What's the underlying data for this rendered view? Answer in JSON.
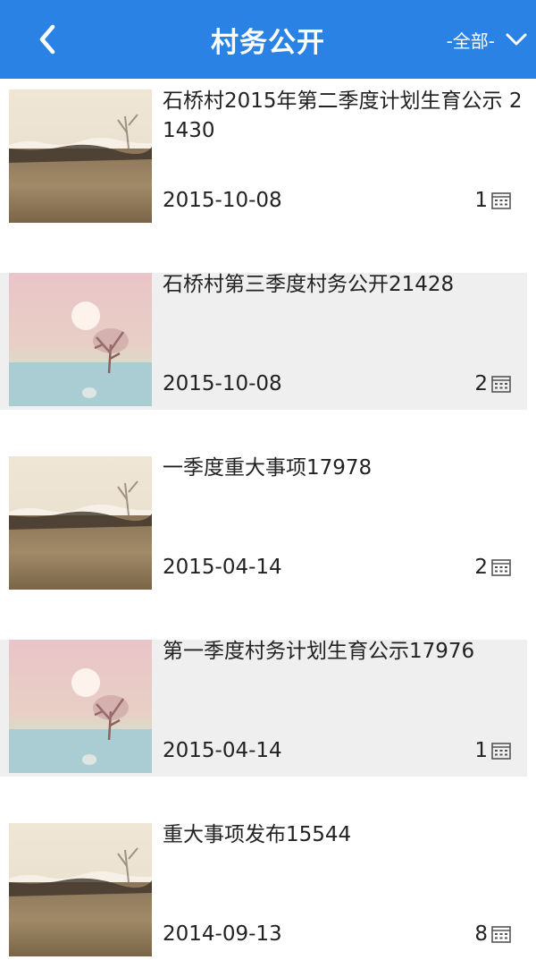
{
  "header": {
    "title": "村务公开",
    "filter_label": "-全部-",
    "bg_color": "#2a82e4"
  },
  "icons": {
    "back": "chevron-left-icon",
    "filter": "chevron-down-icon",
    "count": "calendar-icon"
  },
  "items": [
    {
      "title": "石桥村2015年第二季度计划生育公示 21430",
      "date": "2015-10-08",
      "count": "1",
      "thumb": "field"
    },
    {
      "title": "石桥村第三季度村务公开21428",
      "date": "2015-10-08",
      "count": "2",
      "thumb": "tree"
    },
    {
      "title": "一季度重大事项17978",
      "date": "2015-04-14",
      "count": "2",
      "thumb": "field"
    },
    {
      "title": "第一季度村务计划生育公示17976",
      "date": "2015-04-14",
      "count": "1",
      "thumb": "tree"
    },
    {
      "title": "重大事项发布15544",
      "date": "2014-09-13",
      "count": "8",
      "thumb": "field"
    }
  ]
}
